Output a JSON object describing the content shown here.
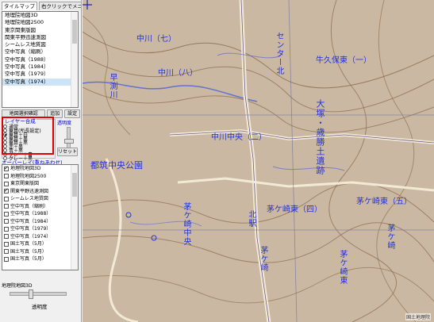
{
  "panel": {
    "tabs": [
      "タイルマップ",
      "右クリックでメニュー"
    ],
    "tile_list": [
      "地理院地図3D",
      "地理院地図2500",
      "東京関東版図",
      "関東平野迅速測図",
      "シームレス地質図",
      "空中写真（縮刷）",
      "空中写真（1988）",
      "空中写真（1984）",
      "空中写真（1979）",
      "空中写真（1974）"
    ],
    "buttons": {
      "settings_check": "地図選択確認",
      "add": "追加",
      "config": "設定"
    },
    "layer_blend": {
      "legend": "レイヤー合成",
      "options": [
        "通常",
        "乗算(所長設定)",
        "乗算＋白",
        "乗算＋黒",
        "乗算＋黒",
        "赤＋黒",
        "青＋黒",
        "グレー＋青",
        "グレー＋黒"
      ],
      "selected_index": 2
    },
    "opacity_label": "透明度",
    "reset_label": "リセット",
    "overlay_label": "オーバーレイ(重ねあわせ)",
    "overlay_items": [
      {
        "label": "地理院地図3D",
        "checked": true
      },
      {
        "label": "地理院地図2500",
        "checked": false
      },
      {
        "label": "東京関東版図",
        "checked": false
      },
      {
        "label": "関東平野迅速測図",
        "checked": true
      },
      {
        "label": "シームレス地質図",
        "checked": false
      },
      {
        "label": "空中写真（縮刷）",
        "checked": false
      },
      {
        "label": "空中写真（1988）",
        "checked": false
      },
      {
        "label": "空中写真（1984）",
        "checked": false
      },
      {
        "label": "空中写真（1979）",
        "checked": false
      },
      {
        "label": "空中写真（1974）",
        "checked": false
      },
      {
        "label": "国土写真（5月）",
        "checked": false
      },
      {
        "label": "国土写真（5月）",
        "checked": false
      },
      {
        "label": "国土写真（5月）",
        "checked": false
      }
    ],
    "selected_layer": "地理院地図3D",
    "transparency_label": "透明度",
    "transparency_value": 0.35
  },
  "map": {
    "labels": {
      "nakagawa7": "中川（七）",
      "nakagawa8": "中川（八）",
      "ushikubo": "牛久保東（一）",
      "hayabuchi": "早渕川",
      "nakagawachuo": "中川中央（二）",
      "ooduka": "大塚・歳勝土遺跡",
      "park": "都筑中央公園",
      "chigasakihigashi4": "茅ケ崎東（四）",
      "chigasakihigashi5": "茅ケ崎東（五）",
      "chigasakichuo": "茅ケ崎中央",
      "chigasaki": "茅ケ崎",
      "station": "センター北",
      "kita": "北駅",
      "chigasakihigashi_v": "茅ケ崎東"
    },
    "credit": "国土地理院"
  },
  "colors": {
    "map_base": "#c9b7a4",
    "label": "#2233d8",
    "contour": "#8a6a4a",
    "road": "#f2e6d0",
    "grid": "#7a7a99",
    "highlight_frame": "#e00000"
  }
}
